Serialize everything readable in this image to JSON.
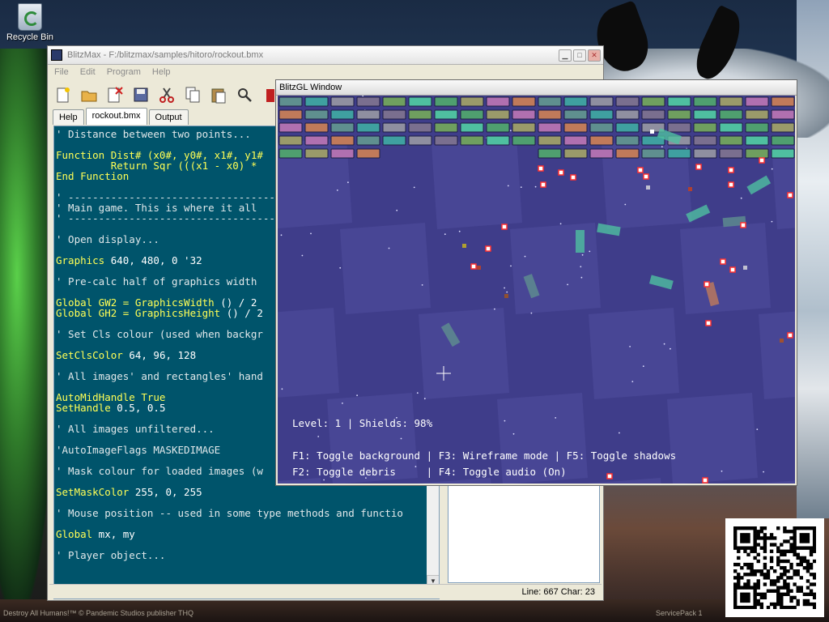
{
  "desktop": {
    "recycle_bin_label": "Recycle Bin",
    "bottom_text_left": "Destroy All Humans!™ © Pandemic Studios publisher THQ",
    "bottom_text_right": "ServicePack 1"
  },
  "ide": {
    "title": "BlitzMax - F:/blitzmax/samples/hitoro/rockout.bmx",
    "menu": [
      "File",
      "Edit",
      "Program",
      "Help"
    ],
    "toolbar_icons": [
      "new-file-icon",
      "open-folder-icon",
      "close-file-icon",
      "save-icon",
      "cut-icon",
      "copy-icon",
      "paste-icon",
      "find-icon",
      "build-icon"
    ],
    "tabs": [
      "Help",
      "rockout.bmx",
      "Output"
    ],
    "active_tab": "rockout.bmx",
    "status": "Line: 667 Char: 23",
    "code_lines": [
      {
        "t": "c",
        "s": "' Distance between two points..."
      },
      {
        "t": "n",
        "s": ""
      },
      {
        "t": "k",
        "s": "Function Dist# (x0#, y0#, x1#, y1#"
      },
      {
        "t": "k",
        "s": "         Return Sqr (((x1 - x0) *"
      },
      {
        "t": "k",
        "s": "End Function"
      },
      {
        "t": "n",
        "s": ""
      },
      {
        "t": "c",
        "s": "' -----------------------------------"
      },
      {
        "t": "c",
        "s": "' Main game. This is where it all"
      },
      {
        "t": "c",
        "s": "' -----------------------------------"
      },
      {
        "t": "n",
        "s": ""
      },
      {
        "t": "c",
        "s": "' Open display..."
      },
      {
        "t": "n",
        "s": ""
      },
      {
        "t": "m",
        "a": "Graphics",
        "b": " 640, 480, 0 '32"
      },
      {
        "t": "n",
        "s": ""
      },
      {
        "t": "c",
        "s": "' Pre-calc half of graphics width"
      },
      {
        "t": "n",
        "s": ""
      },
      {
        "t": "g",
        "a": "Global GW2 = ",
        "b": "GraphicsWidth",
        "c": " () / 2"
      },
      {
        "t": "g",
        "a": "Global GH2 = ",
        "b": "GraphicsHeight",
        "c": " () / 2"
      },
      {
        "t": "n",
        "s": ""
      },
      {
        "t": "c",
        "s": "' Set Cls colour (used when backgr"
      },
      {
        "t": "n",
        "s": ""
      },
      {
        "t": "m",
        "a": "SetClsColor",
        "b": " 64, 96, 128"
      },
      {
        "t": "n",
        "s": ""
      },
      {
        "t": "c",
        "s": "' All images' and rectangles' hand"
      },
      {
        "t": "n",
        "s": ""
      },
      {
        "t": "k",
        "s": "AutoMidHandle True"
      },
      {
        "t": "m",
        "a": "SetHandle",
        "b": " 0.5, 0.5"
      },
      {
        "t": "n",
        "s": ""
      },
      {
        "t": "c",
        "s": "' All images unfiltered..."
      },
      {
        "t": "n",
        "s": ""
      },
      {
        "t": "c",
        "s": "'AutoImageFlags MASKEDIMAGE"
      },
      {
        "t": "n",
        "s": ""
      },
      {
        "t": "c",
        "s": "' Mask colour for loaded images (w"
      },
      {
        "t": "n",
        "s": ""
      },
      {
        "t": "m",
        "a": "SetMaskColor",
        "b": " 255, 0, 255"
      },
      {
        "t": "n",
        "s": ""
      },
      {
        "t": "c",
        "s": "' Mouse position -- used in some type methods and functio"
      },
      {
        "t": "n",
        "s": ""
      },
      {
        "t": "m",
        "a": "Global",
        "b": " mx, my"
      },
      {
        "t": "n",
        "s": ""
      },
      {
        "t": "c",
        "s": "' Player object..."
      }
    ]
  },
  "game": {
    "title": "BlitzGL Window",
    "hud_status": "Level: 1 | Shields: 98%",
    "hud_help_1": "F1: Toggle background | F3: Wireframe mode | F5: Toggle shadows",
    "hud_help_2": "F2: Toggle debris     | F4: Toggle audio (On)",
    "colors": {
      "background": "#3f3d8a",
      "checker_light": "#4a4897",
      "ball": "#ff3030",
      "brick_palette": [
        "#5f8f8f",
        "#7a6f8f",
        "#4f9f6f",
        "#c07a5a",
        "#8f8fa0",
        "#4fbfa0",
        "#b070b0",
        "#3fa0a0",
        "#6f9f5f",
        "#9a9a6a"
      ]
    }
  }
}
